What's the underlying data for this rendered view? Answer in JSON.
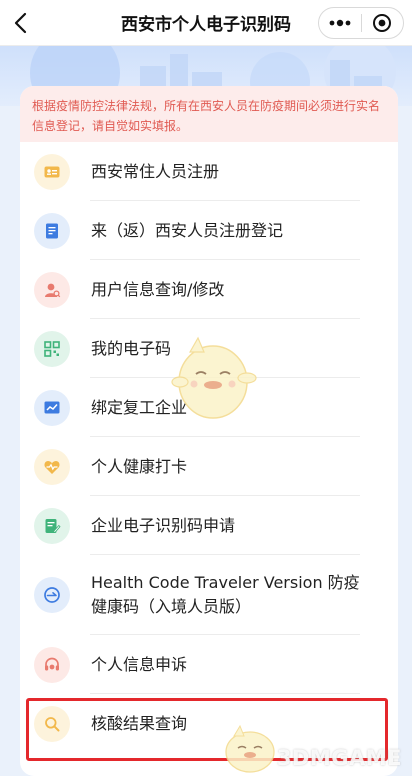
{
  "header": {
    "title": "西安市个人电子识别码",
    "back_icon": "chevron-left-icon",
    "more_icon": "more-dots-icon",
    "close_icon": "target-close-icon"
  },
  "notice": "根据疫情防控法律法规，所有在西安人员在防疫期间必须进行实名信息登记，请自觉如实填报。",
  "menu": [
    {
      "label": "西安常住人员注册",
      "icon": "id-card-icon",
      "color": "#f2b84b",
      "bg": "#fdf3dc"
    },
    {
      "label": "来（返）西安人员注册登记",
      "icon": "document-edit-icon",
      "color": "#3d7be0",
      "bg": "#e3edfb"
    },
    {
      "label": "用户信息查询/修改",
      "icon": "user-search-icon",
      "color": "#e87a6e",
      "bg": "#fde9e6"
    },
    {
      "label": "我的电子码",
      "icon": "qr-code-icon",
      "color": "#3fb37a",
      "bg": "#e1f4ea"
    },
    {
      "label": "绑定复工企业",
      "icon": "chart-icon",
      "color": "#3d7be0",
      "bg": "#e3edfb"
    },
    {
      "label": "个人健康打卡",
      "icon": "heart-pulse-icon",
      "color": "#f2b84b",
      "bg": "#fdf3dc"
    },
    {
      "label": "企业电子识别码申请",
      "icon": "form-edit-icon",
      "color": "#3fb37a",
      "bg": "#e1f4ea"
    },
    {
      "label": "Health Code Traveler Version 防疫健康码（入境人员版）",
      "icon": "plane-entry-icon",
      "color": "#3d7be0",
      "bg": "#e3edfb"
    },
    {
      "label": "个人信息申诉",
      "icon": "headset-icon",
      "color": "#e87a6e",
      "bg": "#fde9e6"
    },
    {
      "label": "核酸结果查询",
      "icon": "magnifier-icon",
      "color": "#f2b84b",
      "bg": "#fdf3dc"
    }
  ],
  "watermark": "3DMGAME",
  "colors": {
    "highlight": "#e4282c",
    "notice_text": "#e05a52",
    "notice_bg": "#fdeceb"
  }
}
